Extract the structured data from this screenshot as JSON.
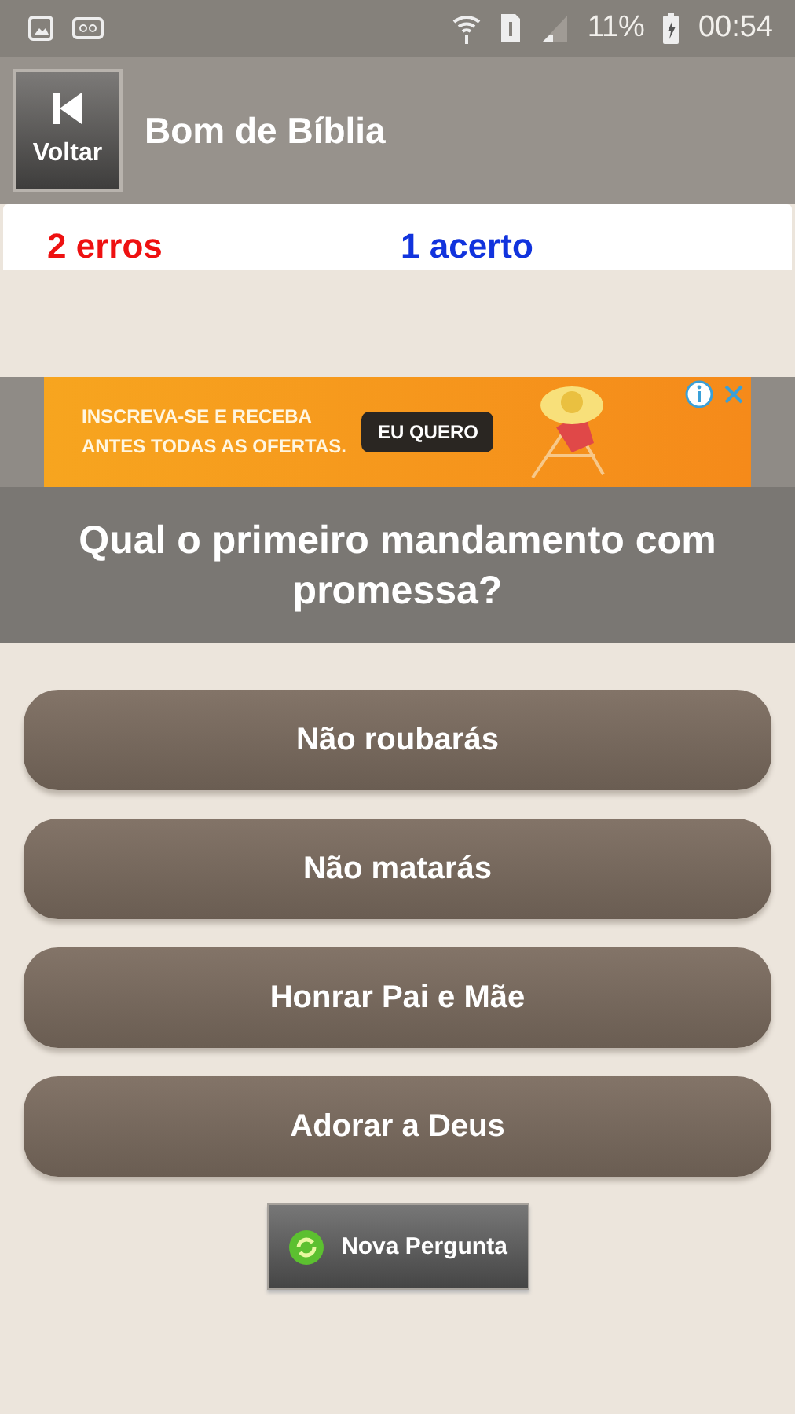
{
  "status_bar": {
    "battery": "11%",
    "time": "00:54"
  },
  "header": {
    "back_label": "Voltar",
    "title": "Bom de Bíblia"
  },
  "score": [
    {
      "text": "2 erros",
      "color": "#ee1111"
    },
    {
      "text": "1 acerto",
      "color": "#1133dd"
    }
  ],
  "ad": {
    "line_1": "INSCREVA-SE E RECEBA",
    "line_2": "ANTES TODAS AS OFERTAS.",
    "cta": "EU QUERO"
  },
  "question": "Qual o primeiro mandamento com promessa?",
  "answers": [
    "Não roubarás",
    "Não matarás",
    "Honrar Pai e Mãe",
    "Adorar a Deus"
  ],
  "new_question": "Nova Pergunta"
}
